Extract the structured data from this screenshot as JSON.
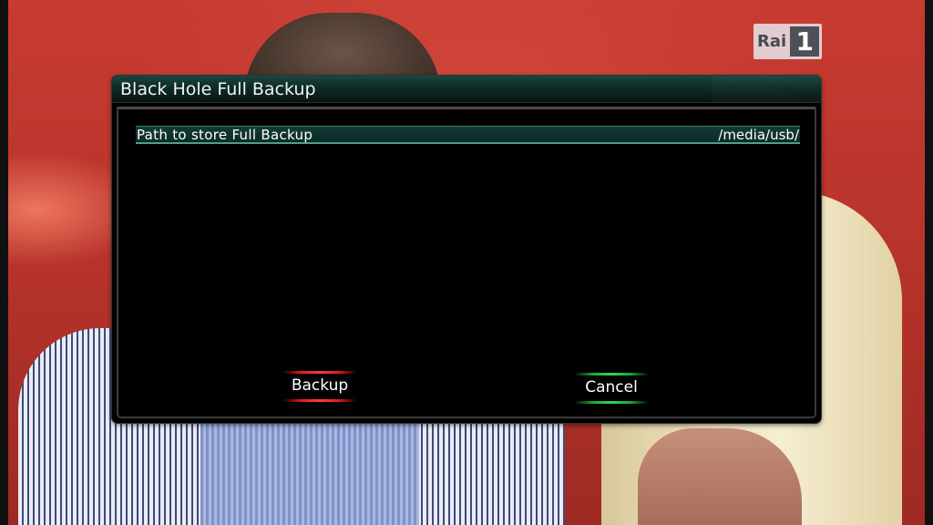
{
  "channel_logo": {
    "name": "Rai",
    "number": "1"
  },
  "dialog": {
    "title": "Black Hole Full Backup",
    "config_rows": [
      {
        "label": "Path to store Full Backup",
        "value": "/media/usb/",
        "selected": true
      }
    ],
    "buttons": {
      "red": {
        "label": "Backup",
        "color": "#e41b1b"
      },
      "green": {
        "label": "Cancel",
        "color": "#1ea836"
      }
    }
  }
}
